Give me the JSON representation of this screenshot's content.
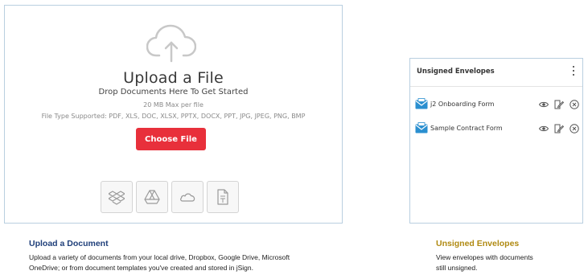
{
  "upload": {
    "title": "Upload a File",
    "subtitle": "Drop Documents Here To Get Started",
    "max_size": "20 MB Max per file",
    "file_types": "File Type Supported: PDF, XLS, DOC, XLSX, PPTX, DOCX, PPT, JPG, JPEG, PNG, BMP",
    "choose_button": "Choose File",
    "sources": [
      {
        "icon": "dropbox-icon"
      },
      {
        "icon": "google-drive-icon"
      },
      {
        "icon": "onedrive-icon"
      },
      {
        "icon": "document-template-icon"
      }
    ]
  },
  "captions": {
    "upload_title": "Upload a Document",
    "upload_body_line1": "Upload a variety of documents from your local drive, Dropbox, Google Drive, Microsoft",
    "upload_body_line2": "OneDrive; or from document templates you've created and stored in jSign.",
    "envelopes_title": "Unsigned Envelopes",
    "envelopes_body_line1": "View envelopes with documents",
    "envelopes_body_line2": "still unsigned."
  },
  "envelopes": {
    "title": "Unsigned Envelopes",
    "items": [
      {
        "name": "j2 Onboarding Form"
      },
      {
        "name": "Sample Contract Form"
      }
    ]
  },
  "colors": {
    "accent_red": "#e8303b",
    "caption_blue": "#1f3f7a",
    "caption_gold": "#b08a12",
    "envelope_blue": "#2a8fd0"
  }
}
